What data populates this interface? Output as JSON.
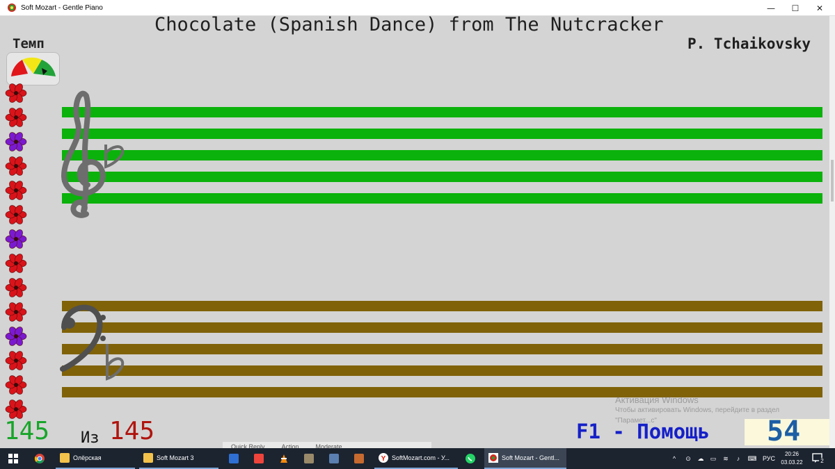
{
  "window": {
    "title": "Soft Mozart - Gentle Piano",
    "minimize": "—",
    "maximize": "☐",
    "close": "✕"
  },
  "song": {
    "title": "Chocolate (Spanish Dance) from The Nutcracker",
    "composer": "P. Tchaikovsky"
  },
  "tempo": {
    "label": "Темп"
  },
  "flowers": [
    "red",
    "red",
    "purple",
    "red",
    "red",
    "red",
    "purple",
    "red",
    "red",
    "red",
    "purple",
    "red",
    "red",
    "red"
  ],
  "colors": {
    "treble_staff": "#0bb20b",
    "bass_staff": "#806208",
    "flower_red": "#d8141a",
    "flower_purple": "#7a1ad0"
  },
  "counter": {
    "current": "145",
    "of_label": "Из",
    "total": "145"
  },
  "help": {
    "text": "F1 - Помощь"
  },
  "score": {
    "value": "54"
  },
  "activation": {
    "title": "Активация Windows",
    "line1": "Чтобы активировать Windows, перейдите в раздел",
    "line2": "\"Парамет...с\""
  },
  "background_bar": {
    "items": [
      "Quick Reply",
      "Action",
      "Moderate"
    ]
  },
  "taskbar": {
    "items": [
      {
        "label": "",
        "icon": "chrome-icon"
      },
      {
        "label": "Олёрская",
        "icon": "folder-icon"
      },
      {
        "label": "Soft Mozart 3",
        "icon": "folder-icon"
      },
      {
        "label": "",
        "icon": "save-icon"
      },
      {
        "label": "",
        "icon": "anydesk-icon"
      },
      {
        "label": "",
        "icon": "vlc-icon"
      },
      {
        "label": "",
        "icon": "tool-icon"
      },
      {
        "label": "",
        "icon": "calculator-icon"
      },
      {
        "label": "",
        "icon": "package-icon"
      },
      {
        "label": "SoftMozart.com - У...",
        "icon": "yandex-icon"
      },
      {
        "label": "",
        "icon": "whatsapp-icon"
      },
      {
        "label": "Soft Mozart - Gentl...",
        "icon": "softmozart-icon"
      }
    ],
    "tray": {
      "language": "РУС",
      "time": "20:26",
      "date": "03.03.22",
      "notifications": "2"
    }
  }
}
